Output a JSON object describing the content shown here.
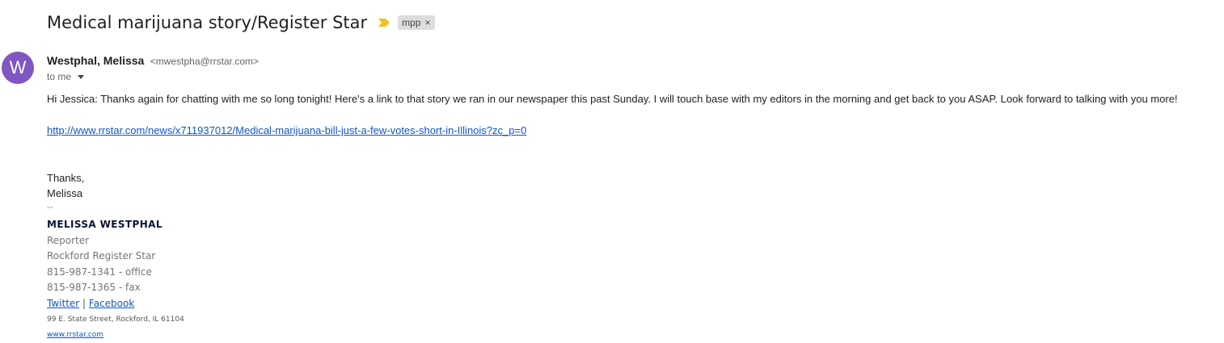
{
  "email": {
    "subject": "Medical marijuana story/Register Star",
    "label": "mpp",
    "label_remove": "×",
    "sender": {
      "avatar_letter": "W",
      "avatar_color": "#7e57c2",
      "name": "Westphal, Melissa",
      "email": "<mwestpha@rrstar.com>"
    },
    "recipient_text": "to me",
    "body": {
      "paragraph1": "Hi Jessica: Thanks again for chatting with me so long tonight! Here's a link to that story we ran in our newspaper this past Sunday. I will touch base with my editors in the morning and get back to you ASAP. Look forward to talking with you more!",
      "link": "http://www.rrstar.com/news/x711937012/Medical-marijuana-bill-just-a-few-votes-short-in-Illinois?zc_p=0",
      "closing": "Thanks,",
      "closing_name": "Melissa",
      "separator": "--"
    },
    "signature": {
      "name": "MELISSA WESTPHAL",
      "title": "Reporter",
      "organization": "Rockford Register Star",
      "phone_office": "815-987-1341 - office",
      "phone_fax": "815-987-1365 - fax",
      "twitter": "Twitter",
      "divider": "|",
      "facebook": "Facebook",
      "address": "99 E. State Street, Rockford, IL  61104",
      "website": "www.rrstar.com"
    }
  },
  "colors": {
    "importance_marker": "#f2c21b",
    "link": "#1155cc"
  },
  "icons": {
    "importance": "importance-marker-icon",
    "dropdown": "chevron-down-icon"
  }
}
